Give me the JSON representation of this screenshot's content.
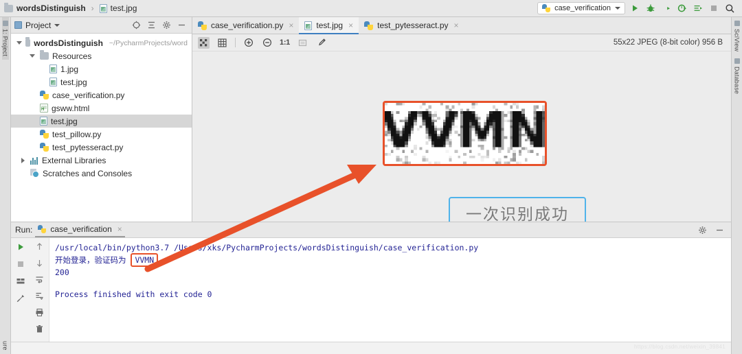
{
  "breadcrumb": {
    "project": "wordsDistinguish",
    "separator": "›",
    "file": "test.jpg"
  },
  "toolbar_right": {
    "run_config": "case_verification",
    "icons": [
      "run-icon",
      "debug-icon",
      "run-coverage-icon",
      "profile-icon",
      "run-dashboard-icon",
      "stop-icon",
      "search-icon"
    ]
  },
  "project_panel": {
    "title": "Project",
    "header_icons": [
      "locate-icon",
      "collapse-all-icon",
      "settings-gear-icon",
      "hide-panel-icon"
    ],
    "tree": [
      {
        "label": "wordsDistinguish",
        "path": "~/PycharmProjects/word",
        "icon": "folder-icon",
        "indent": 0,
        "bold": true,
        "expanded": true,
        "selected": false
      },
      {
        "label": "Resources",
        "path": "",
        "icon": "folder-icon",
        "indent": 1,
        "bold": false,
        "expanded": true,
        "selected": false
      },
      {
        "label": "1.jpg",
        "path": "",
        "icon": "image-file-icon",
        "indent": 2,
        "bold": false,
        "expanded": null,
        "selected": false
      },
      {
        "label": "test.jpg",
        "path": "",
        "icon": "image-file-icon",
        "indent": 2,
        "bold": false,
        "expanded": null,
        "selected": false
      },
      {
        "label": "case_verification.py",
        "path": "",
        "icon": "python-file-icon",
        "indent": 1,
        "bold": false,
        "expanded": null,
        "selected": false
      },
      {
        "label": "gsww.html",
        "path": "",
        "icon": "html-file-icon",
        "indent": 1,
        "bold": false,
        "expanded": null,
        "selected": false
      },
      {
        "label": "test.jpg",
        "path": "",
        "icon": "image-file-icon",
        "indent": 1,
        "bold": false,
        "expanded": null,
        "selected": true
      },
      {
        "label": "test_pillow.py",
        "path": "",
        "icon": "python-file-icon",
        "indent": 1,
        "bold": false,
        "expanded": null,
        "selected": false
      },
      {
        "label": "test_pytesseract.py",
        "path": "",
        "icon": "python-file-icon",
        "indent": 1,
        "bold": false,
        "expanded": null,
        "selected": false
      },
      {
        "label": "External Libraries",
        "path": "",
        "icon": "libraries-icon",
        "indent": 0,
        "bold": false,
        "expanded": false,
        "selected": false
      },
      {
        "label": "Scratches and Consoles",
        "path": "",
        "icon": "scratches-icon",
        "indent": 0,
        "bold": false,
        "expanded": null,
        "selected": false
      }
    ]
  },
  "editor": {
    "tabs": [
      {
        "label": "case_verification.py",
        "icon": "python-file-icon",
        "active": false
      },
      {
        "label": "test.jpg",
        "icon": "image-file-icon",
        "active": true
      },
      {
        "label": "test_pytesseract.py",
        "icon": "python-file-icon",
        "active": false
      }
    ],
    "close_glyph": "×",
    "image_toolbar": {
      "buttons": [
        "transparency-chessboard-icon",
        "grid-icon",
        "zoom-in-icon",
        "zoom-out-icon",
        "actual-size-icon",
        "fit-to-window-icon",
        "color-picker-icon"
      ],
      "actual_size_label": "1:1"
    },
    "image_info": "55x22 JPEG (8-bit color) 956 B",
    "captcha_text": "VVMN",
    "annotation": "一次识别成功"
  },
  "run_panel": {
    "label": "Run:",
    "tab": "case_verification",
    "close_glyph": "×",
    "header_icons": [
      "settings-gear-icon",
      "hide-panel-icon"
    ],
    "gutter_icons_left": [
      "rerun-icon",
      "stop-icon",
      "layout-icon",
      "pin-icon"
    ],
    "gutter_icons_right": [
      "up-arrow-icon",
      "down-arrow-icon",
      "soft-wrap-icon",
      "scroll-to-end-icon",
      "print-icon",
      "trash-icon"
    ],
    "console": {
      "line1": "/usr/local/bin/python3.7 /Users/xks/PycharmProjects/wordsDistinguish/case_verification.py",
      "line2_prefix": "开始登录，验证码为",
      "line2_highlight": "VVMN",
      "line3": "200",
      "line4": "",
      "line5": "Process finished with exit code 0"
    }
  },
  "tool_stripes": {
    "left": [
      {
        "label": "1: Project",
        "selected": true,
        "icon": "project-icon"
      },
      {
        "label": "ure",
        "selected": false,
        "icon": "structure-icon"
      }
    ],
    "right": [
      {
        "label": "SciView",
        "selected": false,
        "icon": "sciview-icon"
      },
      {
        "label": "Database",
        "selected": false,
        "icon": "database-icon"
      }
    ]
  },
  "status_bar": {
    "watermark": "https://blog.csdn.net/weixin_39841"
  },
  "colors": {
    "accent_orange": "#e8512a",
    "accent_blue": "#4fb3ea",
    "tab_underline": "#3e7fc1",
    "console_text": "#232394",
    "run_green": "#3c9b3c"
  }
}
